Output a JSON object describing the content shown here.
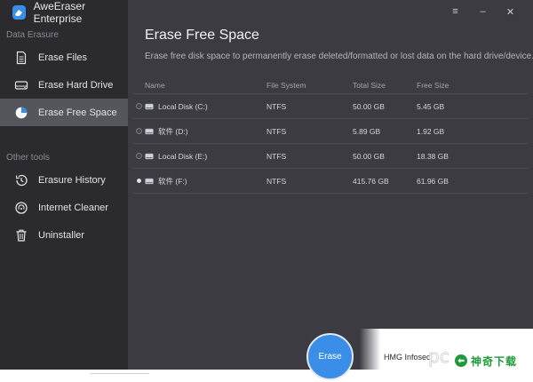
{
  "app": {
    "title": "AweEraser Enterprise",
    "logo_icon": "eraser-logo-icon",
    "accent": "#3b8ee8"
  },
  "sidebar": {
    "section1": "Data Erasure",
    "items1": [
      {
        "label": "Erase Files",
        "icon": "file-icon",
        "active": false
      },
      {
        "label": "Erase Hard Drive",
        "icon": "hard-drive-icon",
        "active": false
      },
      {
        "label": "Erase Free Space",
        "icon": "pie-chart-icon",
        "active": true
      }
    ],
    "section2": "Other tools",
    "items2": [
      {
        "label": "Erasure History",
        "icon": "history-icon"
      },
      {
        "label": "Internet Cleaner",
        "icon": "internet-cleaner-icon"
      },
      {
        "label": "Uninstaller",
        "icon": "trash-icon"
      }
    ]
  },
  "window_controls": {
    "menu": "≡",
    "minimize": "–",
    "close": "✕"
  },
  "main": {
    "title": "Erase Free Space",
    "description": "Erase free disk space to permanently erase deleted/formatted or lost data on the hard drive/device.",
    "table": {
      "headers": {
        "name": "Name",
        "fs": "File System",
        "total": "Total Size",
        "free": "Free Size"
      },
      "rows": [
        {
          "name": "Local Disk (C:)",
          "fs": "NTFS",
          "total": "50.00 GB",
          "free": "5.45 GB",
          "selected": false
        },
        {
          "name": "软件 (D:)",
          "fs": "NTFS",
          "total": "5.89 GB",
          "free": "1.92 GB",
          "selected": false
        },
        {
          "name": "Local Disk (E:)",
          "fs": "NTFS",
          "total": "50.00 GB",
          "free": "18.38 GB",
          "selected": false
        },
        {
          "name": "软件 (F:)",
          "fs": "NTFS",
          "total": "415.76 GB",
          "free": "61.96 GB",
          "selected": true
        }
      ]
    },
    "erase_button": "Erase"
  },
  "footer": {
    "company": "HMG Infosec",
    "watermark_mark": "pc",
    "watermark_text": "神奇下载"
  }
}
